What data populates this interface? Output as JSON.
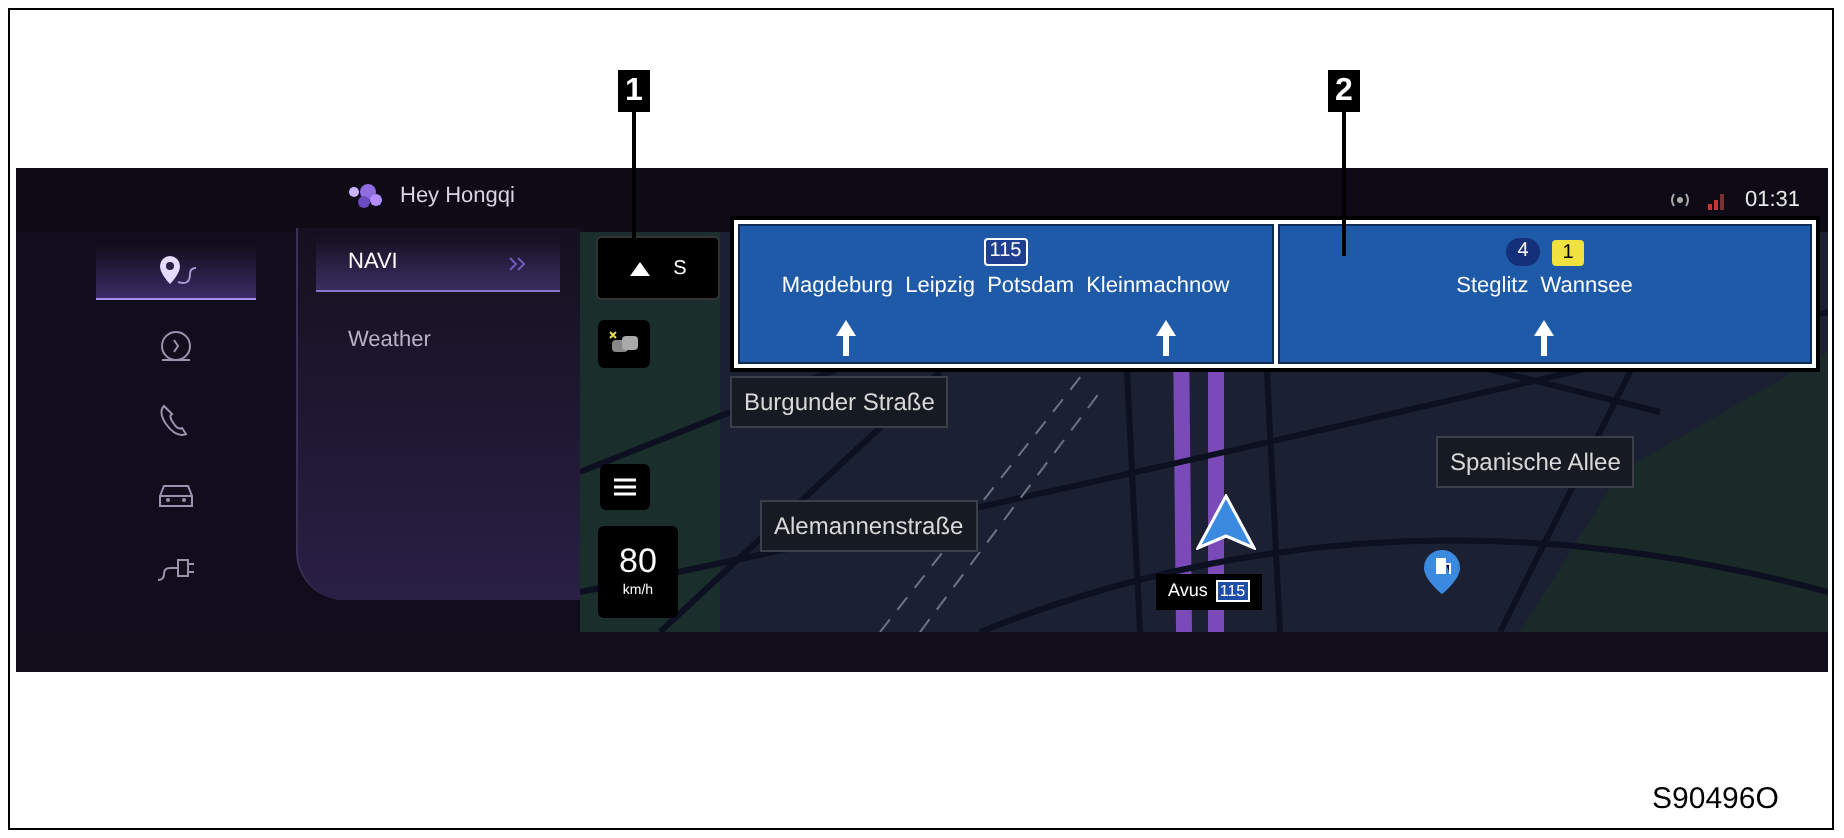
{
  "callouts": [
    {
      "label": "1"
    },
    {
      "label": "2"
    }
  ],
  "voice_assistant": {
    "label": "Hey Hongqi"
  },
  "status_bar": {
    "time": "01:31"
  },
  "side_icons": [
    {
      "kind": "navigation",
      "selected": true
    },
    {
      "kind": "gauge",
      "selected": false
    },
    {
      "kind": "phone",
      "selected": false
    },
    {
      "kind": "car",
      "selected": false
    },
    {
      "kind": "charging",
      "selected": false
    }
  ],
  "menu": [
    {
      "label": "NAVI",
      "selected": true
    },
    {
      "label": "Weather",
      "selected": false
    }
  ],
  "compass": {
    "heading": "S"
  },
  "speed": {
    "value": "80",
    "unit": "km/h"
  },
  "signs": [
    {
      "routes": [
        {
          "label": "115",
          "kind": "motorway"
        }
      ],
      "destinations": "Magdeburg  Leipzig  Potsdam  Kleinmachnow",
      "arrows": [
        {
          "kind": "straight"
        },
        {
          "kind": "straight"
        }
      ]
    },
    {
      "routes": [
        {
          "label": "4",
          "kind": "federal"
        },
        {
          "label": "1",
          "kind": "state"
        }
      ],
      "destinations": "Steglitz  Wannsee",
      "arrows": [
        {
          "kind": "straight"
        }
      ]
    }
  ],
  "map_labels": [
    {
      "text": "Burgunder Straße"
    },
    {
      "text": "Alemannenstraße"
    },
    {
      "text": "Spanische Allee"
    }
  ],
  "road_label": {
    "name": "Avus",
    "route": "115"
  },
  "figure_code": "S90496O"
}
